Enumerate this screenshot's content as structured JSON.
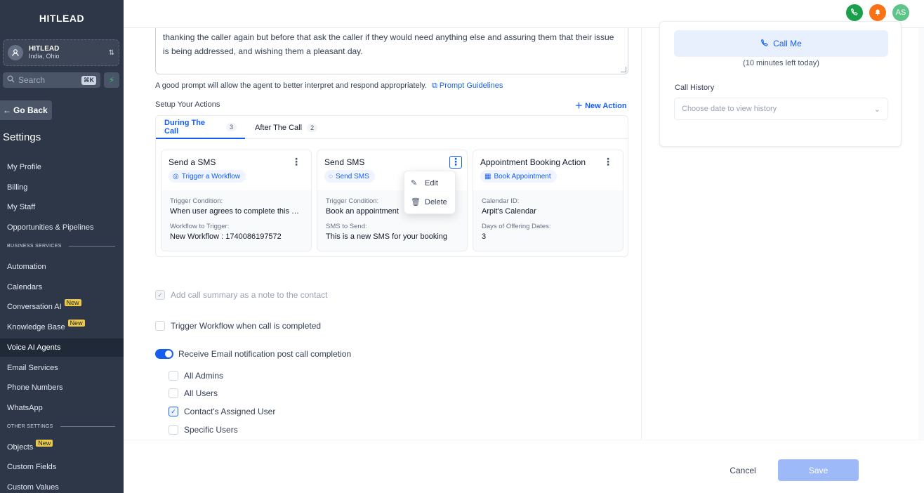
{
  "sidebar": {
    "brand": "HITLEAD",
    "location": {
      "name": "HITLEAD",
      "sub": "India, Ohio"
    },
    "search": {
      "placeholder": "Search",
      "shortcut": "⌘K"
    },
    "go_back": "Go Back",
    "settings_title": "Settings",
    "items_top": [
      "My Profile",
      "Billing",
      "My Staff",
      "Opportunities & Pipelines"
    ],
    "section_business": "BUSINESS SERVICES",
    "items_business": [
      "Automation",
      "Calendars",
      "Conversation AI",
      "Knowledge Base",
      "Voice AI Agents",
      "Email Services",
      "Phone Numbers",
      "WhatsApp"
    ],
    "section_other": "OTHER SETTINGS",
    "items_other": [
      "Objects",
      "Custom Fields",
      "Custom Values"
    ],
    "badge_new": "New"
  },
  "topbar": {
    "avatar_initials": "AS"
  },
  "prompt": {
    "text": "thanking the caller again but before that ask the caller if they would need anything else and  assuring them that their issue is being addressed, and wishing them a pleasant day."
  },
  "helper": {
    "text": "A good prompt will allow the agent to better interpret and respond appropriately.",
    "link": "Prompt Guidelines"
  },
  "actions": {
    "title": "Setup Your Actions",
    "new_action": "New Action",
    "tabs": [
      {
        "label": "During The Call",
        "count": "3"
      },
      {
        "label": "After The Call",
        "count": "2"
      }
    ],
    "cards": [
      {
        "title": "Send a SMS",
        "chip": "Trigger a Workflow",
        "k1": "Trigger Condition:",
        "v1": "When user agrees to complete this appointment",
        "k2": "Workflow to Trigger:",
        "v2": "New Workflow : 1740086197572"
      },
      {
        "title": "Send SMS",
        "chip": "Send SMS",
        "k1": "Trigger Condition:",
        "v1": "Book an appointment",
        "k2": "SMS to Send:",
        "v2": "This is a new SMS for your booking"
      },
      {
        "title": "Appointment Booking Action",
        "chip": "Book Appointment",
        "k1": "Calendar ID:",
        "v1": "Arpit's Calendar",
        "k2": "Days of Offering Dates:",
        "v2": "3"
      }
    ],
    "menu": {
      "edit": "Edit",
      "delete": "Delete"
    }
  },
  "options": {
    "call_summary": "Add call summary as a note to the contact",
    "trigger_workflow": "Trigger Workflow when call is completed",
    "email_notify": "Receive Email notification post call completion",
    "recipients": [
      "All Admins",
      "All Users",
      "Contact's Assigned User",
      "Specific Users"
    ]
  },
  "right": {
    "call_me": "Call Me",
    "minutes_left": "(10 minutes left today)",
    "history_label": "Call History",
    "history_placeholder": "Choose date to view history"
  },
  "footer": {
    "cancel": "Cancel",
    "save": "Save"
  },
  "colors": {
    "sidebar_bg": "#2d3748",
    "accent": "#155eef",
    "new_badge": "#ecc94b",
    "phone_green": "#1a9f4b",
    "bell_orange": "#f97316",
    "avatar_green": "#5fc48a"
  }
}
